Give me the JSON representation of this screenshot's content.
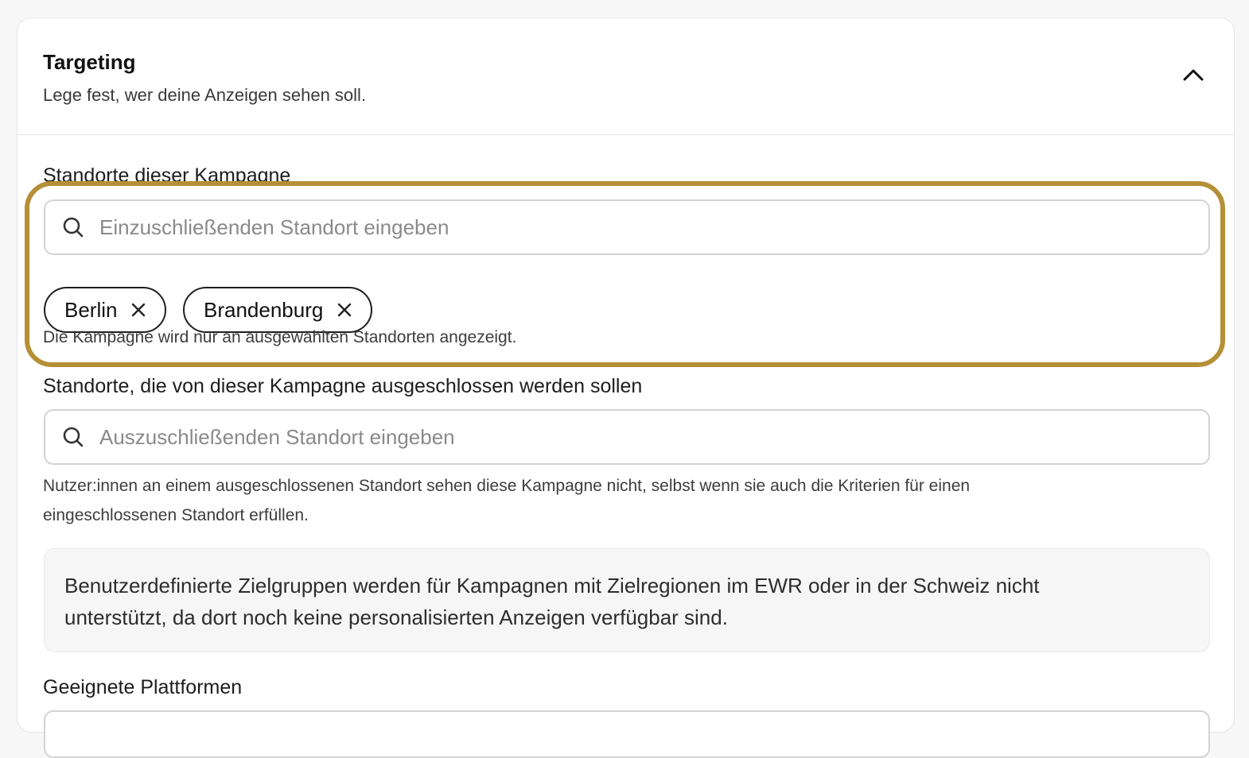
{
  "header": {
    "title": "Targeting",
    "subtitle": "Lege fest, wer deine Anzeigen sehen soll.",
    "collapse_icon": "chevron-up-icon"
  },
  "include_locations": {
    "label": "Standorte dieser Kampagne",
    "search_placeholder": "Einzuschließenden Standort eingeben",
    "search_value": "",
    "chips": [
      {
        "label": "Berlin"
      },
      {
        "label": "Brandenburg"
      }
    ],
    "help": "Die Kampagne wird nur an ausgewählten Standorten angezeigt.",
    "highlight_color": "#b58f35"
  },
  "exclude_locations": {
    "label": "Standorte, die von dieser Kampagne ausgeschlossen werden sollen",
    "search_placeholder": "Auszuschließenden Standort eingeben",
    "search_value": "",
    "help_line1": "Nutzer:innen an einem ausgeschlossenen Standort sehen diese Kampagne nicht, selbst wenn sie auch die Kriterien für einen",
    "help_line2": "eingeschlossenen Standort erfüllen."
  },
  "info_notice": {
    "line1": "Benutzerdefinierte Zielgruppen werden für Kampagnen mit Zielregionen im EWR oder in der Schweiz nicht",
    "line2": "unterstützt, da dort noch keine personalisierten Anzeigen verfügbar sind."
  },
  "platforms": {
    "label": "Geeignete Plattformen"
  }
}
